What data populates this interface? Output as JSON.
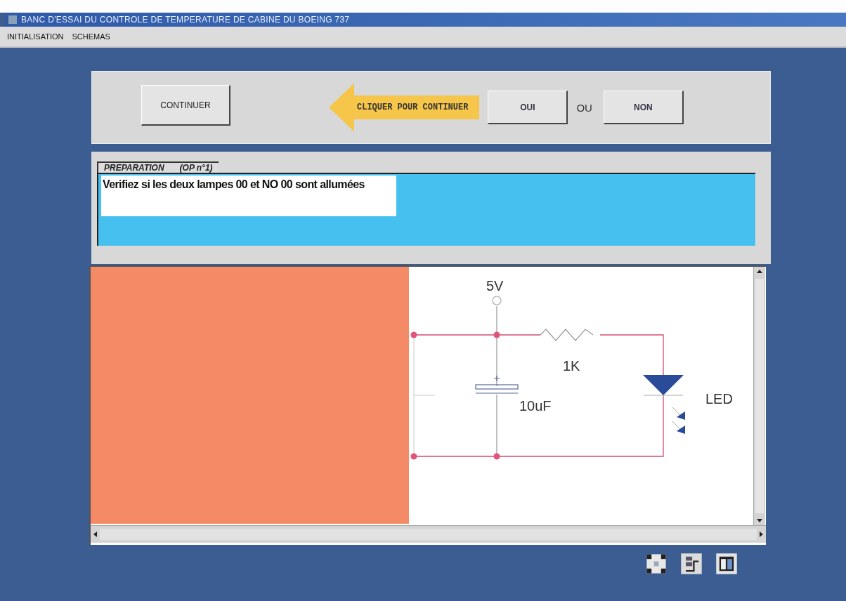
{
  "window": {
    "title": "BANC D'ESSAI DU CONTROLE DE TEMPERATURE DE CABINE DU BOEING 737"
  },
  "menu": [
    "INITIALISATION",
    "SCHEMAS"
  ],
  "toolbar": {
    "continue_button": "CONTINUER",
    "hint": "CLIQUER POUR CONTINUER",
    "yes_button": "OUI",
    "separator": "OU",
    "no_button": "NON"
  },
  "message": {
    "tab": "PREPARATION",
    "step": "(OP n°1)",
    "text": "Verifiez si les deux lampes 00 et NO 00 sont allumées"
  },
  "schematic": {
    "labels": [
      "5V",
      "1K",
      "10uF",
      "LED"
    ]
  }
}
